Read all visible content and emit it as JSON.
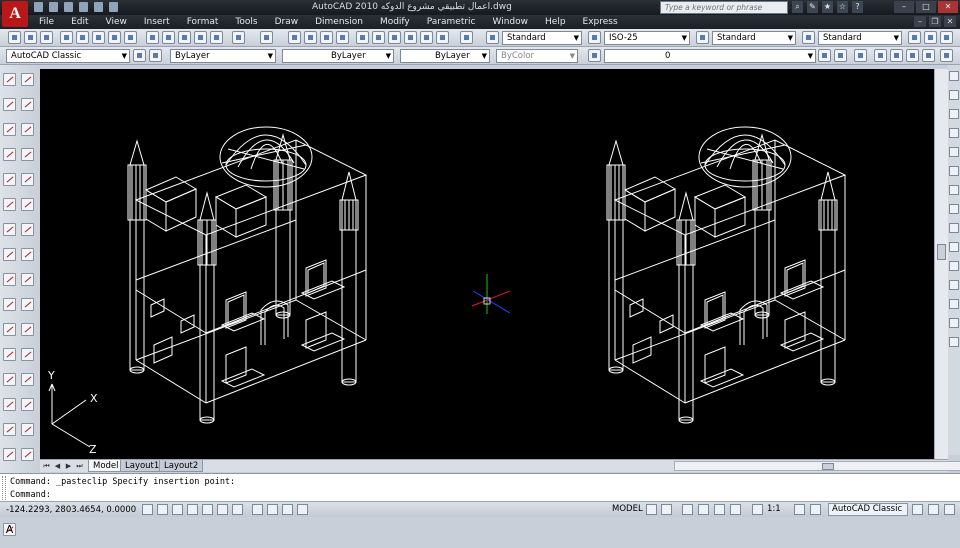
{
  "app": {
    "title": "AutoCAD 2010   اعمال تطبيقي مشروع الدوكه.dwg",
    "logo_letter": "A",
    "search_placeholder": "Type a keyword or phrase"
  },
  "menu": [
    "File",
    "Edit",
    "View",
    "Insert",
    "Format",
    "Tools",
    "Draw",
    "Dimension",
    "Modify",
    "Parametric",
    "Window",
    "Help",
    "Express"
  ],
  "toolbar": {
    "text_style": "Standard",
    "dim_style": "ISO-25",
    "table_style": "Standard",
    "multileader_style": "Standard",
    "workspace": "AutoCAD Classic",
    "layer_filter": "ByLayer",
    "linetype": "ByLayer",
    "lineweight": "ByLayer",
    "plotstyle": "ByColor",
    "layer": "0"
  },
  "ucs": {
    "y": "Y",
    "x": "X",
    "z": "Z"
  },
  "tabs": [
    "Model",
    "Layout1",
    "Layout2"
  ],
  "active_tab": "Model",
  "command": {
    "line1": "Command: _pasteclip Specify insertion point:",
    "line2": "Command:"
  },
  "status": {
    "coords": "-124.2293, 2803.4654, 0.0000",
    "model_label": "MODEL",
    "scale": "1:1",
    "workspace": "AutoCAD Classic"
  },
  "colors": {
    "canvas": "#000000",
    "drawing": "#ffffff",
    "accent": "#b81818"
  }
}
